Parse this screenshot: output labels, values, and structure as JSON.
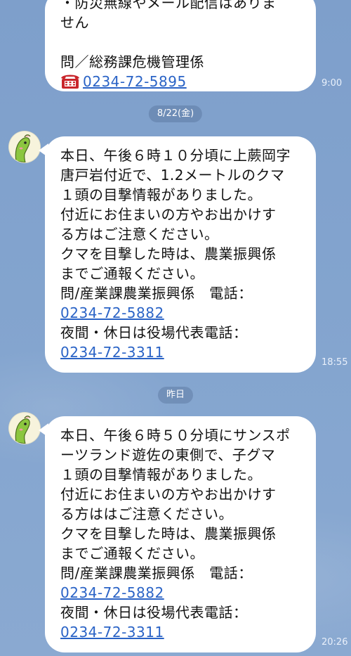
{
  "msg1": {
    "lines": [
      "・防災無線やメール配信はありま",
      "せん",
      "",
      "問／総務課危機管理係"
    ],
    "phone": "0234-72-5895",
    "time": "9:00"
  },
  "date_label_1": "8/22(金)",
  "msg2": {
    "lines": [
      "本日、午後６時１０分頃に上蕨岡字",
      "唐戸岩付近で、1.2メートルのクマ",
      "１頭の目撃情報がありました。",
      "付近にお住まいの方やお出かけす",
      "る方はご注意ください。",
      "クマを目撃した時は、農業振興係",
      "までご通報ください。",
      "問/産業課農業振興係　電話："
    ],
    "phone1": "0234-72-5882",
    "line_after": "夜間・休日は役場代表電話：",
    "phone2": "0234-72-3311",
    "time": "18:55"
  },
  "date_label_2": "昨日",
  "msg3": {
    "lines": [
      "本日、午後６時５０分頃にサンスポ",
      "ーツランド遊佐の東側で、子グマ",
      "１頭の目撃情報がありました。",
      "付近にお住まいの方やお出かけす",
      "る方ははご注意ください。",
      "クマを目撃した時は、農業振興係",
      "までご通報ください。",
      "問/産業課農業振興係　電話："
    ],
    "phone1": "0234-72-5882",
    "line_after": "夜間・休日は役場代表電話：",
    "phone2": "0234-72-3311",
    "time": "20:26"
  },
  "icons": {
    "phone": "telephone-icon",
    "avatar": "mascot-avatar-icon"
  }
}
